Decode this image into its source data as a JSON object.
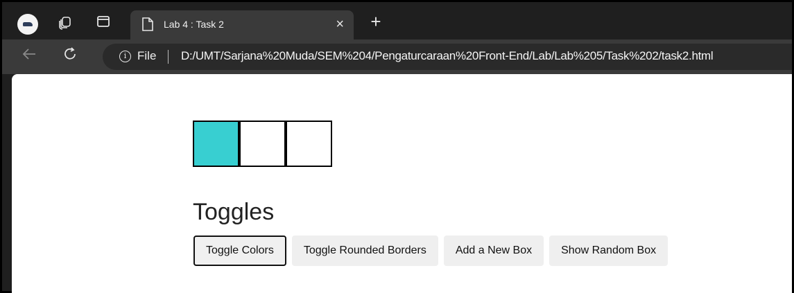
{
  "browser": {
    "tab_title": "Lab 4 : Task 2",
    "tab_close": "×",
    "new_tab": "+",
    "address_prefix": "File",
    "url": "D:/UMT/Sarjana%20Muda/SEM%204/Pengaturcaraan%20Front-End/Lab/Lab%205/Task%202/task2.html"
  },
  "page": {
    "boxes": [
      {
        "color": "#38cfd1"
      },
      {
        "color": "#ffffff"
      },
      {
        "color": "#ffffff"
      }
    ],
    "heading": "Toggles",
    "buttons": [
      {
        "label": "Toggle Colors"
      },
      {
        "label": "Toggle Rounded Borders"
      },
      {
        "label": "Add a New Box"
      },
      {
        "label": "Show Random Box"
      }
    ]
  }
}
